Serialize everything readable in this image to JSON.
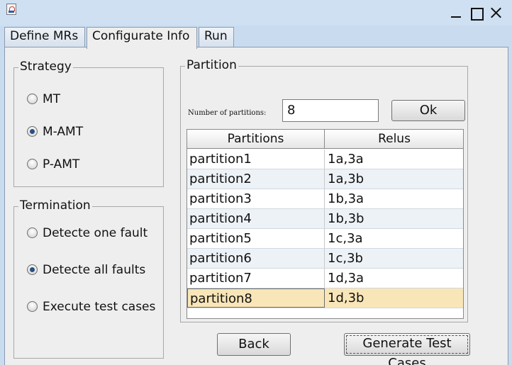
{
  "window": {
    "icons": [
      "java-app-icon",
      "minimize-icon",
      "maximize-icon",
      "close-icon"
    ]
  },
  "tabs": [
    {
      "label": "Define MRs"
    },
    {
      "label": "Configurate Info"
    },
    {
      "label": "Run"
    }
  ],
  "strategy": {
    "title": "Strategy",
    "options": [
      {
        "label": "MT",
        "selected": false
      },
      {
        "label": "M-AMT",
        "selected": true
      },
      {
        "label": "P-AMT",
        "selected": false
      }
    ]
  },
  "termination": {
    "title": "Termination",
    "options": [
      {
        "label": "Detecte one fault",
        "selected": false
      },
      {
        "label": "Detecte all faults",
        "selected": true
      },
      {
        "label": "Execute test cases",
        "selected": false
      }
    ]
  },
  "partition": {
    "title": "Partition",
    "count_label": "Number of partitions:",
    "count_value": "8",
    "ok_label": "Ok",
    "columns": [
      "Partitions",
      "Relus"
    ],
    "rows": [
      {
        "name": "partition1",
        "relus": "1a,3a"
      },
      {
        "name": "partition2",
        "relus": "1a,3b"
      },
      {
        "name": "partition3",
        "relus": "1b,3a"
      },
      {
        "name": "partition4",
        "relus": "1b,3b"
      },
      {
        "name": "partition5",
        "relus": "1c,3a"
      },
      {
        "name": "partition6",
        "relus": "1c,3b"
      },
      {
        "name": "partition7",
        "relus": "1d,3a"
      },
      {
        "name": "partition8",
        "relus": "1d,3b"
      }
    ],
    "selected_row": "partition8"
  },
  "actions": {
    "back_label": "Back",
    "generate_label": "Generate Test Cases"
  }
}
